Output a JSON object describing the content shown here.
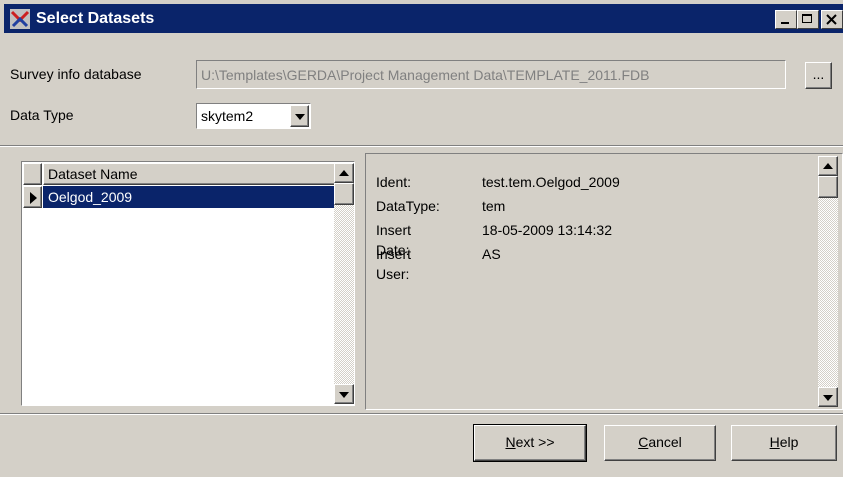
{
  "window": {
    "title": "Select Datasets",
    "controls": {
      "minimize": "minimize-icon",
      "maximize": "maximize-icon",
      "close": "close-icon"
    }
  },
  "survey": {
    "label": "Survey info database",
    "path": "U:\\Templates\\GERDA\\Project Management Data\\TEMPLATE_2011.FDB",
    "browse_label": "..."
  },
  "data_type": {
    "label": "Data Type",
    "selected": "skytem2"
  },
  "dataset_grid": {
    "column_header": "Dataset Name",
    "rows": [
      {
        "name": "Oelgod_2009",
        "selected": true
      }
    ]
  },
  "info": {
    "ident_label": "Ident:",
    "ident_value": "test.tem.Oelgod_2009",
    "datatype_label": "DataType:",
    "datatype_value": "tem",
    "insert_date_label": "Insert Date:",
    "insert_date_value": "18-05-2009 13:14:32",
    "insert_user_label": "Insert User:",
    "insert_user_value": "AS"
  },
  "buttons": {
    "next_hotkey": "N",
    "next_rest": "ext >>",
    "cancel_hotkey": "C",
    "cancel_rest": "ancel",
    "help_hotkey": "H",
    "help_rest": "elp"
  },
  "colors": {
    "titlebar": "#0a246a",
    "face": "#d4d0c8",
    "selection": "#0a246a"
  }
}
